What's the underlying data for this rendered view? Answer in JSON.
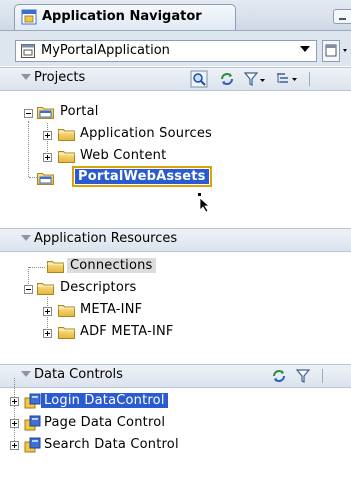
{
  "window": {
    "title": "Application Navigator"
  },
  "app_selector": {
    "value": "MyPortalApplication"
  },
  "projects": {
    "title": "Projects",
    "tree": {
      "root": "Portal",
      "children": [
        "Application Sources",
        "Web Content"
      ],
      "selected_sibling": "PortalWebAssets"
    }
  },
  "app_resources": {
    "title": "Application Resources",
    "connections": "Connections",
    "descriptors": "Descriptors",
    "descriptor_children": [
      "META-INF",
      "ADF META-INF"
    ]
  },
  "data_controls": {
    "title": "Data Controls",
    "items": [
      "Login DataControl",
      "Page Data Control",
      "Search Data Control"
    ]
  },
  "colors": {
    "selection": "#2a5bd0",
    "focus": "#d9a400",
    "folder": "#f0c84a"
  }
}
